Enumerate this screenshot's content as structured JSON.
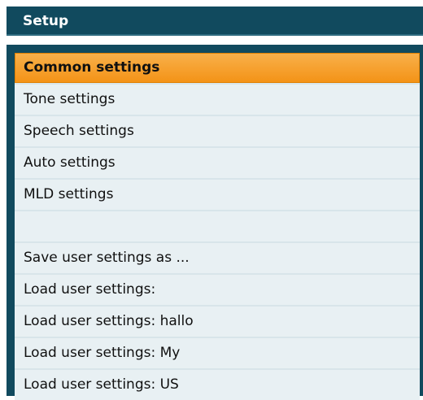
{
  "header": {
    "title": "Setup"
  },
  "menu": {
    "items": [
      "Common settings",
      "Tone settings",
      "Speech settings",
      "Auto settings",
      "MLD settings",
      "",
      "Save user settings as ...",
      "Load user settings:",
      "Load user settings: hallo",
      "Load user settings: My",
      "Load user settings: US"
    ],
    "selected_index": 0
  },
  "colors": {
    "header_bg": "#114a5e",
    "row_bg": "#e8f0f3",
    "selected_bg": "#f49317"
  }
}
